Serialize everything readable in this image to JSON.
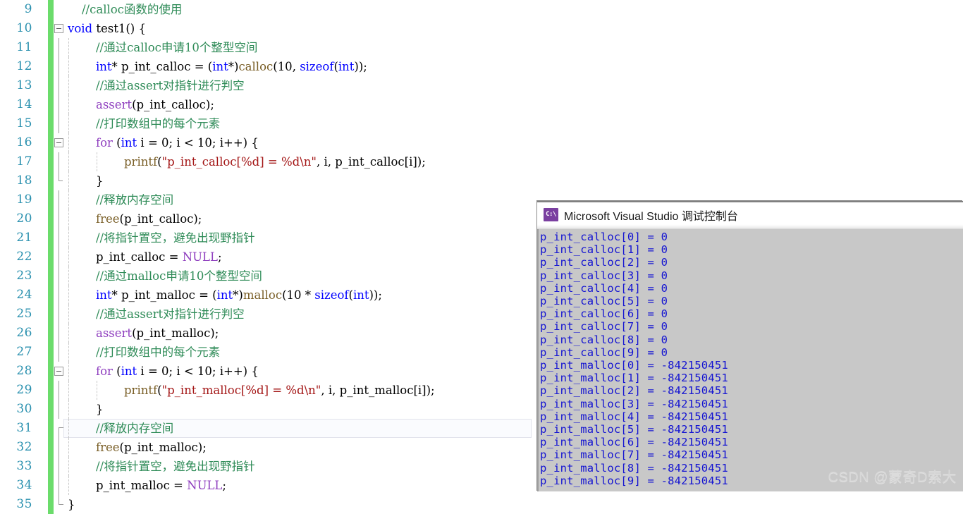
{
  "editor": {
    "first_line_number": 9,
    "current_line_number": 31,
    "lines": [
      {
        "num": "9",
        "indent": 1,
        "tokens": [
          {
            "c": "t-comment",
            "t": "//calloc函数的使用"
          }
        ]
      },
      {
        "num": "10",
        "indent": 0,
        "fold": "open",
        "tokens": [
          {
            "c": "t-keyword",
            "t": "void"
          },
          {
            "c": "t-plain",
            "t": " "
          },
          {
            "c": "t-plain",
            "t": "test1"
          },
          {
            "c": "t-plain",
            "t": "() {"
          }
        ]
      },
      {
        "num": "11",
        "indent": 2,
        "tokens": [
          {
            "c": "t-comment",
            "t": "//通过calloc申请10个整型空间"
          }
        ]
      },
      {
        "num": "12",
        "indent": 2,
        "tokens": [
          {
            "c": "t-keyword",
            "t": "int"
          },
          {
            "c": "t-plain",
            "t": "* p_int_calloc = ("
          },
          {
            "c": "t-keyword",
            "t": "int"
          },
          {
            "c": "t-plain",
            "t": "*)"
          },
          {
            "c": "t-func",
            "t": "calloc"
          },
          {
            "c": "t-plain",
            "t": "("
          },
          {
            "c": "t-num",
            "t": "10"
          },
          {
            "c": "t-plain",
            "t": ", "
          },
          {
            "c": "t-keyword",
            "t": "sizeof"
          },
          {
            "c": "t-plain",
            "t": "("
          },
          {
            "c": "t-keyword",
            "t": "int"
          },
          {
            "c": "t-plain",
            "t": "));"
          }
        ]
      },
      {
        "num": "13",
        "indent": 2,
        "tokens": [
          {
            "c": "t-comment",
            "t": "//通过assert对指针进行判空"
          }
        ]
      },
      {
        "num": "14",
        "indent": 2,
        "tokens": [
          {
            "c": "t-macro",
            "t": "assert"
          },
          {
            "c": "t-plain",
            "t": "(p_int_calloc);"
          }
        ]
      },
      {
        "num": "15",
        "indent": 2,
        "tokens": [
          {
            "c": "t-comment",
            "t": "//打印数组中的每个元素"
          }
        ]
      },
      {
        "num": "16",
        "indent": 2,
        "fold": "open2",
        "tokens": [
          {
            "c": "t-ctrl",
            "t": "for"
          },
          {
            "c": "t-plain",
            "t": " ("
          },
          {
            "c": "t-keyword",
            "t": "int"
          },
          {
            "c": "t-plain",
            "t": " i = "
          },
          {
            "c": "t-num",
            "t": "0"
          },
          {
            "c": "t-plain",
            "t": "; i < "
          },
          {
            "c": "t-num",
            "t": "10"
          },
          {
            "c": "t-plain",
            "t": "; i++) {"
          }
        ]
      },
      {
        "num": "17",
        "indent": 3,
        "tokens": [
          {
            "c": "t-func",
            "t": "printf"
          },
          {
            "c": "t-plain",
            "t": "("
          },
          {
            "c": "t-str",
            "t": "\"p_int_calloc[%d] = %d\\n\""
          },
          {
            "c": "t-plain",
            "t": ", i, p_int_calloc[i]);"
          }
        ]
      },
      {
        "num": "18",
        "indent": 2,
        "tokens": [
          {
            "c": "t-plain",
            "t": "}"
          }
        ]
      },
      {
        "num": "19",
        "indent": 2,
        "tokens": [
          {
            "c": "t-comment",
            "t": "//释放内存空间"
          }
        ]
      },
      {
        "num": "20",
        "indent": 2,
        "tokens": [
          {
            "c": "t-func",
            "t": "free"
          },
          {
            "c": "t-plain",
            "t": "(p_int_calloc);"
          }
        ]
      },
      {
        "num": "21",
        "indent": 2,
        "tokens": [
          {
            "c": "t-comment",
            "t": "//将指针置空，避免出现野指针"
          }
        ]
      },
      {
        "num": "22",
        "indent": 2,
        "tokens": [
          {
            "c": "t-plain",
            "t": "p_int_calloc = "
          },
          {
            "c": "t-macro",
            "t": "NULL"
          },
          {
            "c": "t-plain",
            "t": ";"
          }
        ]
      },
      {
        "num": "23",
        "indent": 2,
        "tokens": [
          {
            "c": "t-comment",
            "t": "//通过malloc申请10个整型空间"
          }
        ]
      },
      {
        "num": "24",
        "indent": 2,
        "tokens": [
          {
            "c": "t-keyword",
            "t": "int"
          },
          {
            "c": "t-plain",
            "t": "* p_int_malloc = ("
          },
          {
            "c": "t-keyword",
            "t": "int"
          },
          {
            "c": "t-plain",
            "t": "*)"
          },
          {
            "c": "t-func",
            "t": "malloc"
          },
          {
            "c": "t-plain",
            "t": "("
          },
          {
            "c": "t-num",
            "t": "10"
          },
          {
            "c": "t-plain",
            "t": " * "
          },
          {
            "c": "t-keyword",
            "t": "sizeof"
          },
          {
            "c": "t-plain",
            "t": "("
          },
          {
            "c": "t-keyword",
            "t": "int"
          },
          {
            "c": "t-plain",
            "t": "));"
          }
        ]
      },
      {
        "num": "25",
        "indent": 2,
        "tokens": [
          {
            "c": "t-comment",
            "t": "//通过assert对指针进行判空"
          }
        ]
      },
      {
        "num": "26",
        "indent": 2,
        "tokens": [
          {
            "c": "t-macro",
            "t": "assert"
          },
          {
            "c": "t-plain",
            "t": "(p_int_malloc);"
          }
        ]
      },
      {
        "num": "27",
        "indent": 2,
        "tokens": [
          {
            "c": "t-comment",
            "t": "//打印数组中的每个元素"
          }
        ]
      },
      {
        "num": "28",
        "indent": 2,
        "fold": "open2",
        "tokens": [
          {
            "c": "t-ctrl",
            "t": "for"
          },
          {
            "c": "t-plain",
            "t": " ("
          },
          {
            "c": "t-keyword",
            "t": "int"
          },
          {
            "c": "t-plain",
            "t": " i = "
          },
          {
            "c": "t-num",
            "t": "0"
          },
          {
            "c": "t-plain",
            "t": "; i < "
          },
          {
            "c": "t-num",
            "t": "10"
          },
          {
            "c": "t-plain",
            "t": "; i++) {"
          }
        ]
      },
      {
        "num": "29",
        "indent": 3,
        "tokens": [
          {
            "c": "t-func",
            "t": "printf"
          },
          {
            "c": "t-plain",
            "t": "("
          },
          {
            "c": "t-str",
            "t": "\"p_int_malloc[%d] = %d\\n\""
          },
          {
            "c": "t-plain",
            "t": ", i, p_int_malloc[i]);"
          }
        ]
      },
      {
        "num": "30",
        "indent": 2,
        "tokens": [
          {
            "c": "t-plain",
            "t": "}"
          }
        ]
      },
      {
        "num": "31",
        "indent": 2,
        "current": true,
        "tokens": [
          {
            "c": "t-comment",
            "t": "//释放内存空间"
          }
        ]
      },
      {
        "num": "32",
        "indent": 2,
        "tokens": [
          {
            "c": "t-func",
            "t": "free"
          },
          {
            "c": "t-plain",
            "t": "(p_int_malloc);"
          }
        ]
      },
      {
        "num": "33",
        "indent": 2,
        "tokens": [
          {
            "c": "t-comment",
            "t": "//将指针置空，避免出现野指针"
          }
        ]
      },
      {
        "num": "34",
        "indent": 2,
        "tokens": [
          {
            "c": "t-plain",
            "t": "p_int_malloc = "
          },
          {
            "c": "t-macro",
            "t": "NULL"
          },
          {
            "c": "t-plain",
            "t": ";"
          }
        ]
      },
      {
        "num": "35",
        "indent": 0,
        "tokens": [
          {
            "c": "t-plain",
            "t": "}"
          }
        ]
      }
    ],
    "colors": {
      "line_number": "#2b91af",
      "comment": "#2e8b57",
      "keyword": "#0000ff",
      "macro": "#8f3fbf",
      "control": "#8f3fbf",
      "string": "#a31515",
      "function": "#795e26",
      "change_bar": "#6bdc6b",
      "current_line_bg": "#fafbfe"
    }
  },
  "console": {
    "icon_label": "C:\\",
    "icon_name": "cmd-console-icon",
    "title": "Microsoft Visual Studio 调试控制台",
    "background": "#c8c8c8",
    "text_color": "#1414d2",
    "output": [
      "p_int_calloc[0] = 0",
      "p_int_calloc[1] = 0",
      "p_int_calloc[2] = 0",
      "p_int_calloc[3] = 0",
      "p_int_calloc[4] = 0",
      "p_int_calloc[5] = 0",
      "p_int_calloc[6] = 0",
      "p_int_calloc[7] = 0",
      "p_int_calloc[8] = 0",
      "p_int_calloc[9] = 0",
      "p_int_malloc[0] = -842150451",
      "p_int_malloc[1] = -842150451",
      "p_int_malloc[2] = -842150451",
      "p_int_malloc[3] = -842150451",
      "p_int_malloc[4] = -842150451",
      "p_int_malloc[5] = -842150451",
      "p_int_malloc[6] = -842150451",
      "p_int_malloc[7] = -842150451",
      "p_int_malloc[8] = -842150451",
      "p_int_malloc[9] = -842150451"
    ]
  },
  "watermark": {
    "text": "CSDN @蒙奇D索大"
  }
}
